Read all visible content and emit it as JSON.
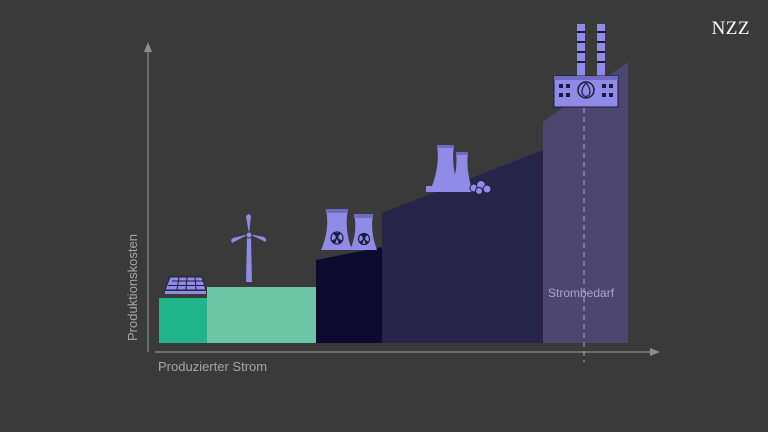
{
  "brand": {
    "logo_text": "NZZ"
  },
  "axes": {
    "x_label": "Produzierter Strom",
    "y_label": "Produktionskosten"
  },
  "annotations": {
    "demand_label": "Strombedarf"
  },
  "icons": [
    "solar-panel-icon",
    "wind-turbine-icon",
    "nuclear-plant-icon",
    "coal-plant-icon",
    "gas-plant-icon"
  ],
  "colors": {
    "background": "#3a3a3a",
    "solar": "#1fb48a",
    "wind": "#6cc6a6",
    "nuclear": "#0c0a2e",
    "coal": "#27244a",
    "gas": "#4c4670",
    "icon": "#8f8be6",
    "axis": "#8c8c8c"
  }
}
